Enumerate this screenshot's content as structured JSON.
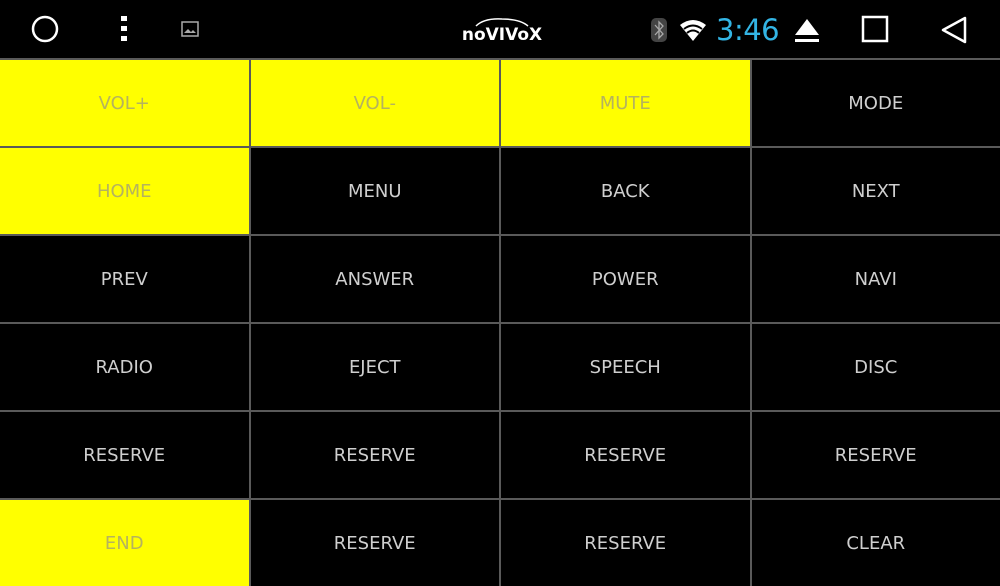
{
  "status_bar": {
    "left_icons": [
      "home-circle-icon",
      "overflow-menu-icon",
      "gallery-icon"
    ],
    "logo_text": "noVIVoX",
    "right_icons": [
      "bluetooth-icon",
      "wifi-icon"
    ],
    "clock": "3:46",
    "nav_icons": [
      "eject-icon",
      "recents-icon",
      "back-icon"
    ],
    "clock_color": "#33b5e5"
  },
  "colors": {
    "active_bg": "#ffff00",
    "active_text": "#b5b35e",
    "inactive_bg": "#000000",
    "inactive_text": "#cfcfcf",
    "grid_line": "#5a5a5a"
  },
  "keys": [
    {
      "label": "VOL+",
      "active": true
    },
    {
      "label": "VOL-",
      "active": true
    },
    {
      "label": "MUTE",
      "active": true
    },
    {
      "label": "MODE",
      "active": false
    },
    {
      "label": "HOME",
      "active": true
    },
    {
      "label": "MENU",
      "active": false
    },
    {
      "label": "BACK",
      "active": false
    },
    {
      "label": "NEXT",
      "active": false
    },
    {
      "label": "PREV",
      "active": false
    },
    {
      "label": "ANSWER",
      "active": false
    },
    {
      "label": "POWER",
      "active": false
    },
    {
      "label": "NAVI",
      "active": false
    },
    {
      "label": "RADIO",
      "active": false
    },
    {
      "label": "EJECT",
      "active": false
    },
    {
      "label": "SPEECH",
      "active": false
    },
    {
      "label": "DISC",
      "active": false
    },
    {
      "label": "RESERVE",
      "active": false
    },
    {
      "label": "RESERVE",
      "active": false
    },
    {
      "label": "RESERVE",
      "active": false
    },
    {
      "label": "RESERVE",
      "active": false
    },
    {
      "label": "END",
      "active": true
    },
    {
      "label": "RESERVE",
      "active": false
    },
    {
      "label": "RESERVE",
      "active": false
    },
    {
      "label": "CLEAR",
      "active": false
    }
  ]
}
